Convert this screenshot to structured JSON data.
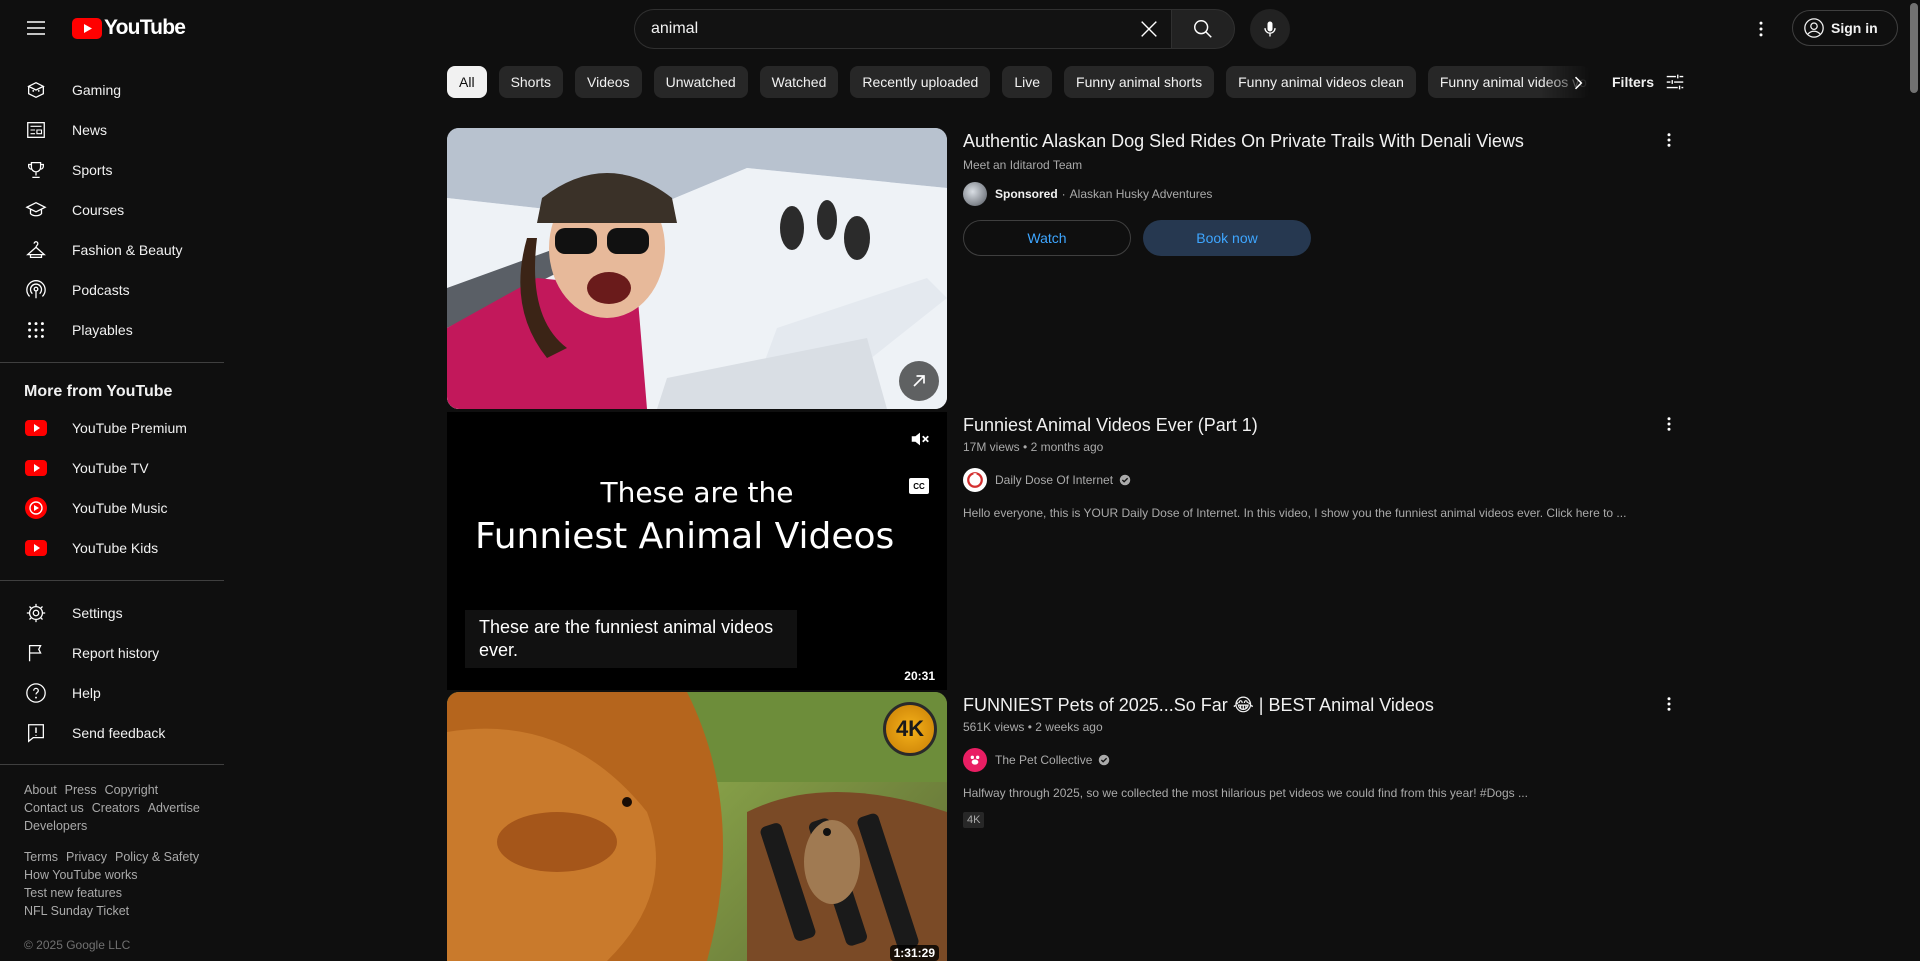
{
  "header": {
    "logo_text": "YouTube",
    "search_value": "animal",
    "sign_in_label": "Sign in"
  },
  "sidebar": {
    "items": [
      {
        "label": "Gaming",
        "icon": "gaming-icon"
      },
      {
        "label": "News",
        "icon": "news-icon"
      },
      {
        "label": "Sports",
        "icon": "trophy-icon"
      },
      {
        "label": "Courses",
        "icon": "courses-icon"
      },
      {
        "label": "Fashion & Beauty",
        "icon": "hanger-icon"
      },
      {
        "label": "Podcasts",
        "icon": "podcast-icon"
      },
      {
        "label": "Playables",
        "icon": "playables-icon"
      }
    ],
    "more_heading": "More from YouTube",
    "more_items": [
      {
        "label": "YouTube Premium",
        "icon": "youtube-premium-icon"
      },
      {
        "label": "YouTube TV",
        "icon": "youtube-tv-icon"
      },
      {
        "label": "YouTube Music",
        "icon": "youtube-music-icon"
      },
      {
        "label": "YouTube Kids",
        "icon": "youtube-kids-icon"
      }
    ],
    "settings_items": [
      {
        "label": "Settings",
        "icon": "gear-icon"
      },
      {
        "label": "Report history",
        "icon": "flag-icon"
      },
      {
        "label": "Help",
        "icon": "help-icon"
      },
      {
        "label": "Send feedback",
        "icon": "feedback-icon"
      }
    ],
    "footer": {
      "row1": [
        "About",
        "Press",
        "Copyright"
      ],
      "row2": [
        "Contact us",
        "Creators",
        "Advertise"
      ],
      "row3": [
        "Developers"
      ],
      "row4": [
        "Terms",
        "Privacy",
        "Policy & Safety"
      ],
      "row5": [
        "How YouTube works"
      ],
      "row6": [
        "Test new features"
      ],
      "row7": [
        "NFL Sunday Ticket"
      ],
      "copyright": "© 2025 Google LLC"
    }
  },
  "chips": [
    "All",
    "Shorts",
    "Videos",
    "Unwatched",
    "Watched",
    "Recently uploaded",
    "Live",
    "Funny animal shorts",
    "Funny animal videos clean",
    "Funny animal videos vo"
  ],
  "filters_label": "Filters",
  "results": {
    "ad": {
      "title": "Authentic Alaskan Dog Sled Rides On Private Trails With Denali Views",
      "subtitle": "Meet an Iditarod Team",
      "sponsored": "Sponsored",
      "advertiser": "Alaskan Husky Adventures",
      "watch_label": "Watch",
      "book_label": "Book now"
    },
    "video1": {
      "title": "Funniest Animal Videos Ever (Part 1)",
      "views": "17M views",
      "age": "2 months ago",
      "channel": "Daily Dose Of Internet",
      "description": "Hello everyone, this is YOUR Daily Dose of Internet. In this video, I show you the funniest animal videos ever. Click here to ...",
      "duration": "20:31",
      "thumb_line1": "These are the",
      "thumb_line2": "Funniest Animal Videos",
      "caption": "These are the funniest animal videos ever."
    },
    "video2": {
      "title": "FUNNIEST Pets of 2025...So Far 😂 | BEST Animal Videos",
      "views": "561K views",
      "age": "2 weeks ago",
      "channel": "The Pet Collective",
      "description": "Halfway through 2025, so we collected the most hilarious pet videos we could find from this year! #Dogs ...",
      "badge": "4K",
      "thumb_badge": "4K",
      "duration": "1:31:29"
    }
  },
  "colors": {
    "background": "#0f0f0f",
    "accent": "#3ea6ff",
    "brand_red": "#ff0000"
  }
}
